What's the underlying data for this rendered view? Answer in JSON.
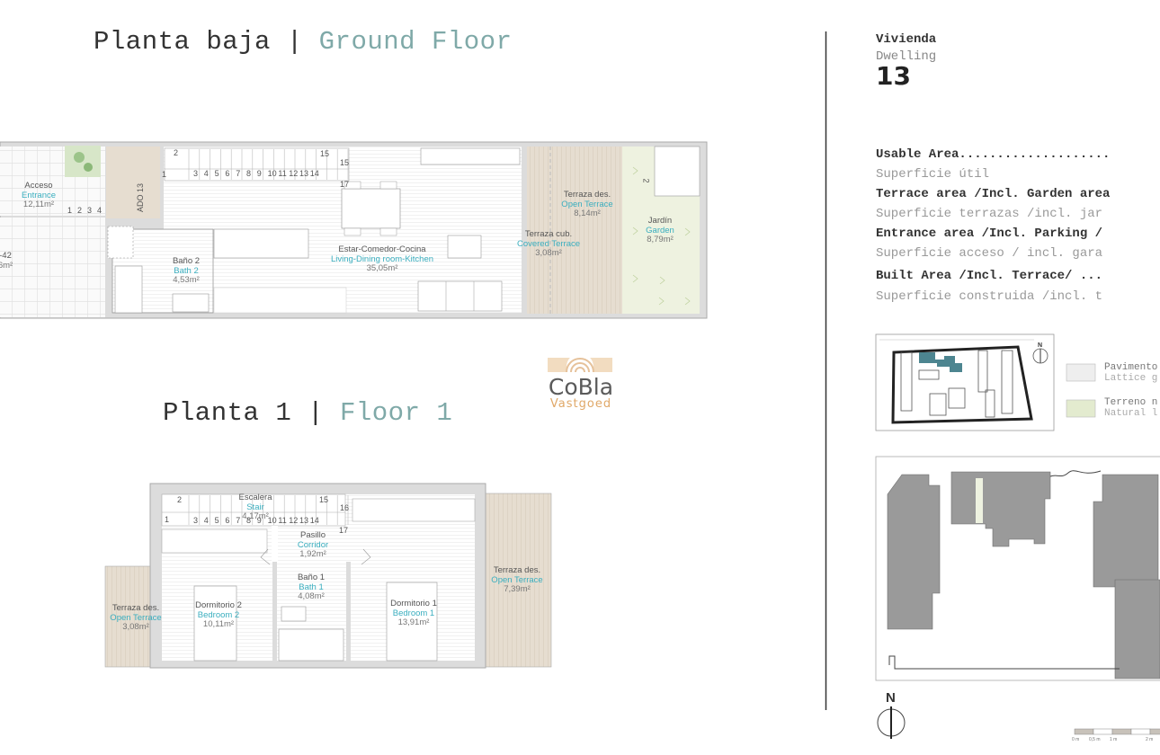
{
  "ground_floor": {
    "title_es": "Planta baja",
    "separator": "|",
    "title_en": "Ground Floor",
    "rooms": [
      {
        "es": "Acceso",
        "en": "Entrance",
        "area": "12,11m²"
      },
      {
        "es": "-42",
        "area": "6m²"
      },
      {
        "es": "Baño 2",
        "en": "Bath 2",
        "area": "4,53m²"
      },
      {
        "es": "Estar-Comedor-Cocina",
        "en": "Living-Dining room-Kitchen",
        "area": "35,05m²"
      },
      {
        "es": "Terraza cub.",
        "en": "Covered Terrace",
        "area": "3,08m²"
      },
      {
        "es": "Terraza des.",
        "en": "Open Terrace",
        "area": "8,14m²"
      },
      {
        "es": "Jardín",
        "en": "Garden",
        "area": "8,79m²"
      }
    ],
    "door_label": "ADO 13",
    "entry_steps": [
      "1",
      "2",
      "3",
      "4"
    ],
    "stair_steps": [
      "1",
      "2",
      "3",
      "4",
      "5",
      "6",
      "7",
      "8",
      "9",
      "10",
      "11",
      "12",
      "13",
      "14",
      "15",
      "15",
      "17"
    ],
    "garden_step": "2"
  },
  "floor_1": {
    "title_es": "Planta 1",
    "separator": "|",
    "title_en": "Floor 1",
    "rooms": [
      {
        "es": "Escalera",
        "en": "Stair",
        "area": "4,17m²"
      },
      {
        "es": "Pasillo",
        "en": "Corridor",
        "area": "1,92m²"
      },
      {
        "es": "Baño 1",
        "en": "Bath 1",
        "area": "4,08m²"
      },
      {
        "es": "Dormitorio 2",
        "en": "Bedroom 2",
        "area": "10,11m²"
      },
      {
        "es": "Dormitorio 1",
        "en": "Bedroom 1",
        "area": "13,91m²"
      },
      {
        "es": "Terraza des.",
        "en": "Open Terrace",
        "area": "3,08m²"
      },
      {
        "es": "Terraza des.",
        "en": "Open Terrace",
        "area": "7,39m²"
      }
    ],
    "stair_steps": [
      "1",
      "2",
      "3",
      "4",
      "5",
      "6",
      "7",
      "8",
      "9",
      "10",
      "11",
      "12",
      "13",
      "14",
      "15",
      "16",
      "17"
    ]
  },
  "logo": {
    "line1": "CoBla",
    "line2": "Vastgoed",
    "colors": {
      "text": "#5a5a5a",
      "accent": "#e0a868"
    }
  },
  "dwelling": {
    "label_es": "Vivienda",
    "label_en": "Dwelling",
    "number": "13"
  },
  "areas": [
    {
      "en": "Usable Area....................",
      "es": "Superficie útil"
    },
    {
      "en": "Terrace area /Incl. Garden area",
      "es": "Superficie terrazas /incl. jar"
    },
    {
      "en": "Entrance area /Incl. Parking /",
      "es": "Superficie acceso / incl. gara"
    },
    {
      "en": "Built Area /Incl. Terrace/ ...",
      "es": "Superficie construida /incl. t"
    }
  ],
  "legend": [
    {
      "es": "Pavimento",
      "en": "Lattice g",
      "swatch": "#eeeeee"
    },
    {
      "es": "Terreno n",
      "en": "Natural l",
      "swatch": "#e3ebcf"
    }
  ],
  "site_plan": {
    "north": "N",
    "highlight_color": "#4d8590"
  },
  "north_label": "N",
  "scale_bar": [
    "0 m",
    "0,5 m",
    "1 m",
    "2 m"
  ],
  "colors": {
    "room_en": "#3aaebf",
    "title_en": "#7fa9a8",
    "terrace": "#e6ddd0",
    "garden": "#eef2e0",
    "wall": "#dcdcdc"
  }
}
